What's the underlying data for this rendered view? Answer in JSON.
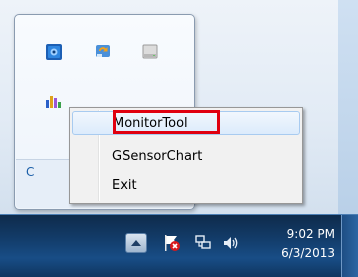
{
  "context_menu": {
    "items": [
      {
        "label": "MonitorTool",
        "selected": true
      },
      {
        "label": "GSensorChart",
        "selected": false
      },
      {
        "label": "Exit",
        "selected": false
      }
    ]
  },
  "flyout": {
    "icons": [
      "network-app-icon",
      "refresh-app-icon",
      "drive-icon",
      "chart-app-icon"
    ],
    "customize_link_fragment": "C"
  },
  "taskbar": {
    "clock": {
      "time": "9:02 PM",
      "date": "6/3/2013"
    },
    "tray_icons": [
      "show-hidden-icons-arrow",
      "action-center-flag-icon",
      "network-icon",
      "volume-icon"
    ]
  },
  "colors": {
    "highlight_box": "#e0000f",
    "taskbar": "#123a66",
    "link": "#1a5ea8"
  }
}
